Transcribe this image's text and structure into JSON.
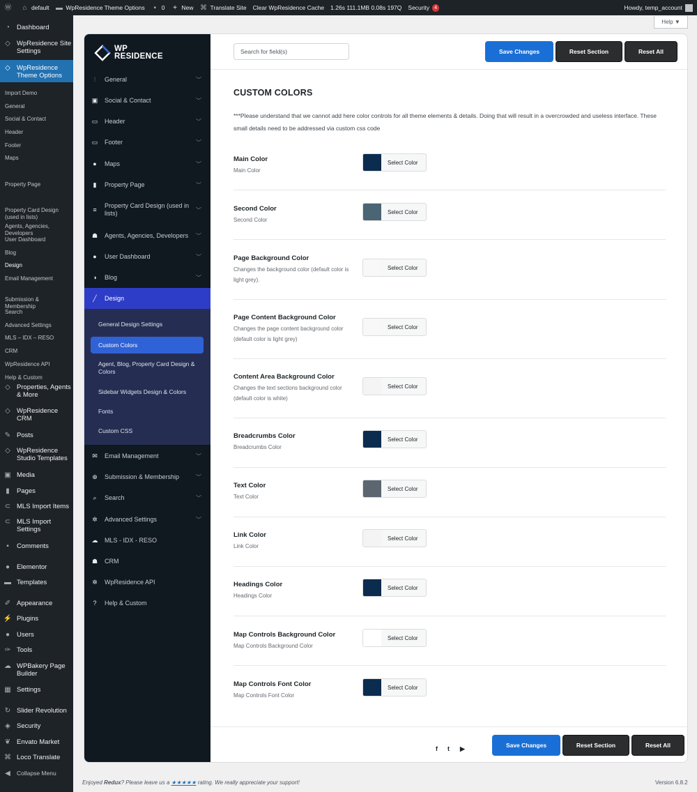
{
  "adminbar": {
    "site": "default",
    "theme_options": "WpResidence Theme Options",
    "comments": "0",
    "new": "New",
    "translate": "Translate Site",
    "clear_cache": "Clear WpResidence Cache",
    "stats": "1.26s  111.1MB  0.08s  197Q",
    "security": "Security",
    "security_count": "4",
    "howdy": "Howdy, temp_account"
  },
  "help_label": "Help ▼",
  "wp_menu": {
    "dashboard": "Dashboard",
    "site_settings": "WpResidence Site Settings",
    "theme_options": "WpResidence Theme Options",
    "submenu": [
      "Import Demo",
      "General",
      "Social & Contact",
      "Header",
      "Footer",
      "Maps",
      "Property Page",
      "Property Card Design (used in lists)",
      "Agents, Agencies, Developers",
      "User Dashboard",
      "Blog",
      "Design",
      "Email Management",
      "Submission & Membership",
      "Search",
      "Advanced Settings",
      "MLS – IDX – RESO",
      "CRM",
      "WpResidence API",
      "Help & Custom"
    ],
    "properties": "Properties, Agents & More",
    "crm": "WpResidence CRM",
    "posts": "Posts",
    "studio": "WpResidence Studio Templates",
    "media": "Media",
    "pages": "Pages",
    "mls_items": "MLS Import Items",
    "mls_settings": "MLS Import Settings",
    "comments": "Comments",
    "elementor": "Elementor",
    "templates": "Templates",
    "appearance": "Appearance",
    "plugins": "Plugins",
    "users": "Users",
    "tools": "Tools",
    "wpbakery": "WPBakery Page Builder",
    "settings": "Settings",
    "slider": "Slider Revolution",
    "security": "Security",
    "envato": "Envato Market",
    "loco": "Loco Translate",
    "collapse": "Collapse Menu"
  },
  "logo": {
    "line1": "WP",
    "line2": "RESIDENCE"
  },
  "sections": [
    {
      "label": "General",
      "icon": "sliders-icon"
    },
    {
      "label": "Social & Contact",
      "icon": "contact-card-icon"
    },
    {
      "label": "Header",
      "icon": "header-icon"
    },
    {
      "label": "Footer",
      "icon": "monitor-icon"
    },
    {
      "label": "Maps",
      "icon": "map-pin-icon"
    },
    {
      "label": "Property Page",
      "icon": "document-icon"
    },
    {
      "label": "Property Card Design (used in lists)",
      "icon": "list-icon"
    },
    {
      "label": "Agents, Agencies, Developers",
      "icon": "users-icon"
    },
    {
      "label": "User Dashboard",
      "icon": "user-icon"
    },
    {
      "label": "Blog",
      "icon": "contrast-icon"
    },
    {
      "label": "Design",
      "icon": "brush-icon"
    }
  ],
  "design_sub": [
    "General Design Settings",
    "Custom Colors",
    "Agent, Blog, Property Card Design & Colors",
    "Sidebar Widgets Design & Colors",
    "Fonts",
    "Custom CSS"
  ],
  "sections2": [
    {
      "label": "Email Management",
      "icon": "envelope-icon"
    },
    {
      "label": "Submission & Membership",
      "icon": "plus-circle-icon"
    },
    {
      "label": "Search",
      "icon": "search-icon"
    },
    {
      "label": "Advanced Settings",
      "icon": "gear-icon"
    },
    {
      "label": "MLS - IDX - RESO",
      "icon": "cloud-icon"
    },
    {
      "label": "CRM",
      "icon": "users-icon"
    },
    {
      "label": "WpResidence API",
      "icon": "gear-icon"
    },
    {
      "label": "Help & Custom",
      "icon": "question-icon"
    }
  ],
  "toolbar": {
    "search_placeholder": "Search for field(s)",
    "save": "Save Changes",
    "reset_section": "Reset Section",
    "reset_all": "Reset All"
  },
  "main": {
    "title": "CUSTOM COLORS",
    "intro": "***Please understand that we cannot add here color controls for all theme elements & details. Doing that will result in a overcrowded and useless interface. These small details need to be addressed via custom css code",
    "select_label": "Select Color",
    "fields": [
      {
        "label": "Main Color",
        "desc": "Main Color",
        "color": "#0b2c4f"
      },
      {
        "label": "Second Color",
        "desc": "Second Color",
        "color": "#4a6574"
      },
      {
        "label": "Page Background Color",
        "desc": "Changes the background color (default color is light grey).",
        "color": "#f8f8f8"
      },
      {
        "label": "Page Content Background Color",
        "desc": "Changes the page content background color (default color is light grey)",
        "color": "#f8f8f8"
      },
      {
        "label": "Content Area Background Color",
        "desc": "Changes the text sections background color (default color is white)",
        "color": "#f4f4f4"
      },
      {
        "label": "Breadcrumbs Color",
        "desc": "Breadcrumbs Color",
        "color": "#0b2c4f"
      },
      {
        "label": "Text Color",
        "desc": "Text Color",
        "color": "#5b6670"
      },
      {
        "label": "Link Color",
        "desc": "Link Color",
        "color": "#f4f4f4"
      },
      {
        "label": "Headings Color",
        "desc": "Headings Color",
        "color": "#0b2c4f"
      },
      {
        "label": "Map Controls Background Color",
        "desc": "Map Controls Background Color",
        "color": "#ffffff"
      },
      {
        "label": "Map Controls Font Color",
        "desc": "Map Controls Font Color",
        "color": "#0b2c4f"
      }
    ]
  },
  "footer": {
    "social": [
      "facebook-icon",
      "twitter-icon",
      "youtube-icon"
    ],
    "save": "Save Changes",
    "reset_section": "Reset Section",
    "reset_all": "Reset All"
  },
  "credit": {
    "pre": "Enjoyed ",
    "redux": "Redux",
    "mid": "? Please leave us a ",
    "stars": "★★★★★",
    "post": " rating. We really appreciate your support!"
  },
  "version": "Version 6.8.2",
  "colors": {
    "accent": "#2271b1",
    "active_section": "#2e3dc7",
    "active_sub": "#2f62d6",
    "save_button": "#1a6fd6"
  }
}
